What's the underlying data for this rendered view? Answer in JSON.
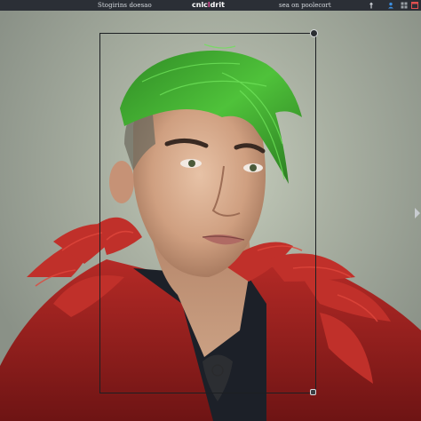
{
  "topbar": {
    "left_text": "Stogirins doesao",
    "brand_part1": "cnlc",
    "brand_part2": "l",
    "brand_part3": "drit",
    "right_text": "sea on poolecort",
    "icons": [
      "pin-icon",
      "user-icon",
      "grid-icon",
      "window-icon"
    ]
  },
  "canvas": {
    "image_alt": "Portrait of a young man with green swept hair wearing a red feathered coat",
    "hair_color": "#3fa52f",
    "coat_color": "#9a1d1d",
    "background_color": "#b4bcac"
  },
  "colors": {
    "topbar_bg": "#2b2f36",
    "brand_accent": "#e94b9a",
    "frame": "#1c1f22"
  }
}
